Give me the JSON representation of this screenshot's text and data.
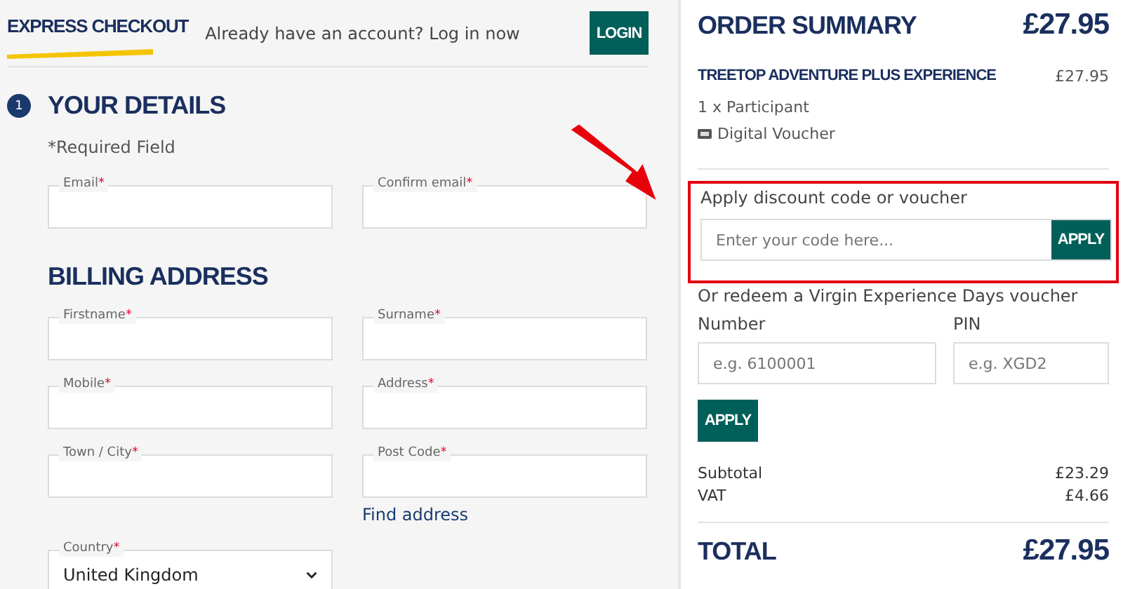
{
  "header": {
    "title": "EXPRESS CHECKOUT",
    "account_prompt": "Already have an account? Log in now",
    "login_button": "LOGIN"
  },
  "details": {
    "step": "1",
    "title": "YOUR DETAILS",
    "required_note": "*Required Field",
    "fields": [
      {
        "label": "Email",
        "required_mark": "*"
      },
      {
        "label": "Confirm email",
        "required_mark": "*"
      }
    ]
  },
  "billing": {
    "title": "BILLING ADDRESS",
    "fields": [
      {
        "label": "Firstname",
        "required_mark": "*"
      },
      {
        "label": "Surname",
        "required_mark": "*"
      },
      {
        "label": "Mobile",
        "required_mark": "*"
      },
      {
        "label": "Address",
        "required_mark": "*"
      },
      {
        "label": "Town / City",
        "required_mark": "*"
      },
      {
        "label": "Post Code",
        "required_mark": "*"
      }
    ],
    "find_address_link": "Find address",
    "country": {
      "label": "Country",
      "required_mark": "*",
      "value": "United Kingdom"
    }
  },
  "order_summary": {
    "title": "ORDER SUMMARY",
    "total_price": "£27.95",
    "item": {
      "name": "TREETOP ADVENTURE PLUS EXPERIENCE",
      "price": "£27.95",
      "quantity": "1 x Participant",
      "delivery": "Digital Voucher"
    },
    "discount": {
      "label": "Apply discount code or voucher",
      "placeholder": "Enter your code here...",
      "button": "APPLY",
      "highlighted": true
    },
    "voucher": {
      "label": "Or redeem a Virgin Experience Days voucher",
      "number_label": "Number",
      "number_placeholder": "e.g. 6100001",
      "pin_label": "PIN",
      "pin_placeholder": "e.g. XGD2",
      "button": "APPLY"
    },
    "totals": [
      {
        "label": "Subtotal",
        "value": "£23.29"
      },
      {
        "label": "VAT",
        "value": "£4.66"
      }
    ],
    "total_label": "TOTAL",
    "total_value": "£27.95"
  }
}
